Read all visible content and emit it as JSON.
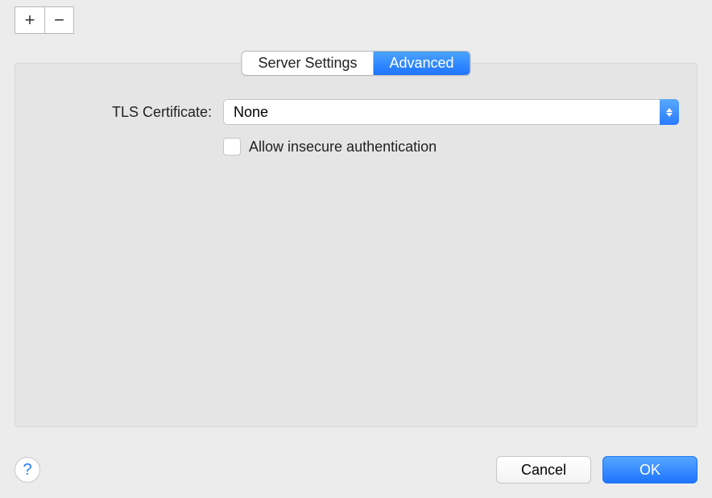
{
  "toolbar": {
    "plus_label": "+",
    "minus_label": "−"
  },
  "tabs": {
    "server_settings_label": "Server Settings",
    "advanced_label": "Advanced",
    "active": "advanced"
  },
  "form": {
    "tls_certificate_label": "TLS Certificate:",
    "tls_certificate_value": "None",
    "allow_insecure_label": "Allow insecure authentication",
    "allow_insecure_checked": false
  },
  "footer": {
    "help_label": "?",
    "cancel_label": "Cancel",
    "ok_label": "OK"
  }
}
